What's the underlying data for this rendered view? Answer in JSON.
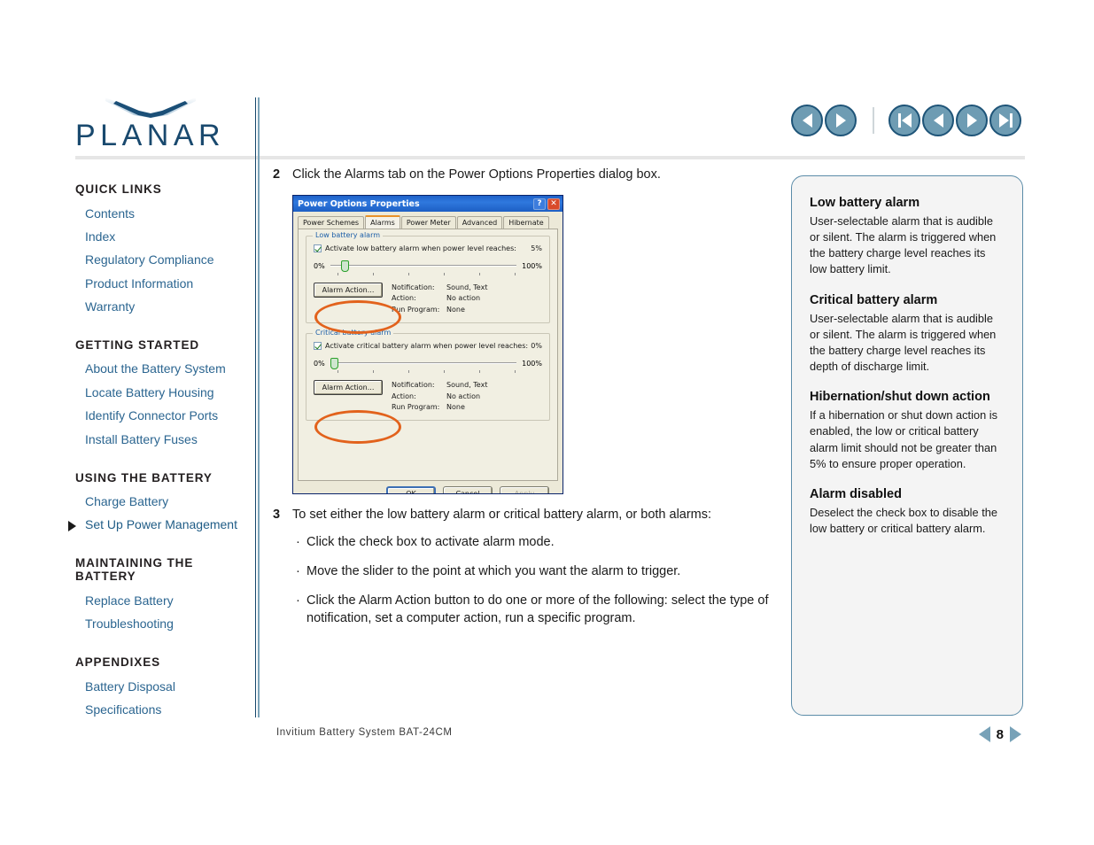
{
  "brand": {
    "name": "PLANAR",
    "logo_icon": "planar-swoosh-logo"
  },
  "topnav": {
    "back_icon": "arrow-left-icon",
    "forward_icon": "arrow-right-icon",
    "first_icon": "skip-to-first-icon",
    "prev_icon": "previous-page-icon",
    "next_icon": "next-page-icon",
    "last_icon": "skip-to-last-icon"
  },
  "sidebar": {
    "sections": [
      {
        "heading": "QUICK LINKS",
        "items": [
          {
            "label": "Contents",
            "active": false
          },
          {
            "label": "Index",
            "active": false
          },
          {
            "label": "Regulatory Compliance",
            "active": false
          },
          {
            "label": "Product Information",
            "active": false
          },
          {
            "label": "Warranty",
            "active": false
          }
        ]
      },
      {
        "heading": "GETTING STARTED",
        "items": [
          {
            "label": "About the Battery System",
            "active": false
          },
          {
            "label": "Locate Battery Housing",
            "active": false
          },
          {
            "label": "Identify Connector Ports",
            "active": false
          },
          {
            "label": "Install Battery  Fuses",
            "active": false
          }
        ]
      },
      {
        "heading": "USING THE BATTERY",
        "items": [
          {
            "label": "Charge Battery",
            "active": false
          },
          {
            "label": "Set Up Power Management",
            "active": true
          }
        ]
      },
      {
        "heading": "MAINTAINING THE BATTERY",
        "items": [
          {
            "label": "Replace Battery",
            "active": false
          },
          {
            "label": "Troubleshooting",
            "active": false
          }
        ]
      },
      {
        "heading": "APPENDIXES",
        "items": [
          {
            "label": "Battery Disposal",
            "active": false
          },
          {
            "label": "Specifications",
            "active": false
          }
        ]
      }
    ]
  },
  "main": {
    "step2": {
      "number": "2",
      "text": "Click the Alarms tab on the Power Options Properties dialog box."
    },
    "step3": {
      "number": "3",
      "text": "To set either the low battery alarm or critical battery alarm, or both alarms:",
      "bullets": [
        "Click the check box to activate alarm mode.",
        "Move the slider to the point at which you want the alarm to trigger.",
        "Click the Alarm Action button to do one or more of the following: select the type of notification, set a computer action, run a specific program."
      ]
    }
  },
  "dialog": {
    "title": "Power Options Properties",
    "help_button": "?",
    "close_button": "✕",
    "tabs": [
      {
        "label": "Power Schemes",
        "active": false
      },
      {
        "label": "Alarms",
        "active": true
      },
      {
        "label": "Power Meter",
        "active": false
      },
      {
        "label": "Advanced",
        "active": false
      },
      {
        "label": "Hibernate",
        "active": false
      }
    ],
    "low_alarm": {
      "group_label": "Low battery alarm",
      "checkbox_label": "Activate low battery alarm when power level reaches:",
      "level": "5%",
      "slider_min": "0%",
      "slider_max": "100%",
      "slider_value": 5,
      "button_label": "Alarm Action...",
      "info": [
        {
          "key": "Notification:",
          "value": "Sound, Text"
        },
        {
          "key": "Action:",
          "value": "No action"
        },
        {
          "key": "Run Program:",
          "value": "None"
        }
      ]
    },
    "critical_alarm": {
      "group_label": "Critical battery alarm",
      "checkbox_label": "Activate critical battery alarm when power level reaches:",
      "level": "0%",
      "slider_min": "0%",
      "slider_max": "100%",
      "slider_value": 0,
      "button_label": "Alarm Action...",
      "info": [
        {
          "key": "Notification:",
          "value": "Sound, Text"
        },
        {
          "key": "Action:",
          "value": "No action"
        },
        {
          "key": "Run Program:",
          "value": "None"
        }
      ]
    },
    "footer": {
      "ok": "OK",
      "cancel": "Cancel",
      "apply": "Apply"
    },
    "annotation_color": "#e2621c"
  },
  "sidepanel": {
    "entries": [
      {
        "heading": "Low battery alarm",
        "body": "User-selectable alarm that is audible or silent. The alarm is triggered when the battery charge level reaches its low battery limit."
      },
      {
        "heading": "Critical battery alarm",
        "body": "User-selectable alarm that is audible or silent. The alarm is triggered when the battery charge level reaches its depth of discharge limit."
      },
      {
        "heading": "Hibernation/shut down action",
        "body": "If a hibernation or shut down action is enabled, the low or critical battery alarm limit should not be greater than 5% to ensure proper operation."
      },
      {
        "heading": "Alarm disabled",
        "body": "Deselect the check box to disable the low battery or critical battery alarm."
      }
    ]
  },
  "footer": {
    "document_title": "Invitium Battery System BAT-24CM",
    "page_number": "8",
    "prev_icon": "page-prev-icon",
    "next_icon": "page-next-icon"
  },
  "colors": {
    "brand_blue": "#19496e",
    "link_blue": "#2b6590",
    "panel_border": "#5b8ca8",
    "annotation_orange": "#e2621c"
  }
}
